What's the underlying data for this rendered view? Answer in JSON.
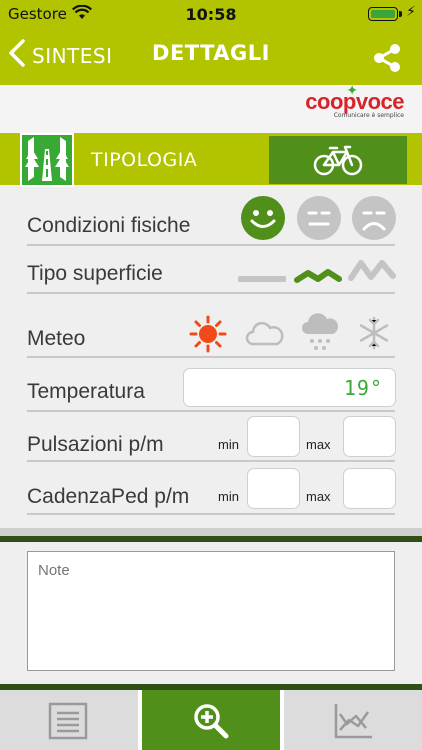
{
  "status": {
    "carrier": "Gestore",
    "time": "10:58"
  },
  "nav": {
    "back_label": "SINTESI",
    "title": "DETTAGLI"
  },
  "logo": {
    "brand_a": "coop",
    "brand_b": "voce",
    "tagline": "Comunicare è semplice"
  },
  "tipologia": {
    "label": "TIPOLOGIA"
  },
  "rows": {
    "condizioni": "Condizioni fisiche",
    "superficie": "Tipo superficie",
    "meteo": "Meteo",
    "temperatura": "Temperatura",
    "pulsazioni": "Pulsazioni p/m",
    "cadenza": "CadenzaPed p/m"
  },
  "temperature_value": "19°",
  "min_label": "min",
  "max_label": "max",
  "notes": {
    "placeholder": "Note"
  },
  "colors": {
    "accent": "#b2c300",
    "green": "#39a935",
    "dark_green": "#4f8f1a"
  }
}
